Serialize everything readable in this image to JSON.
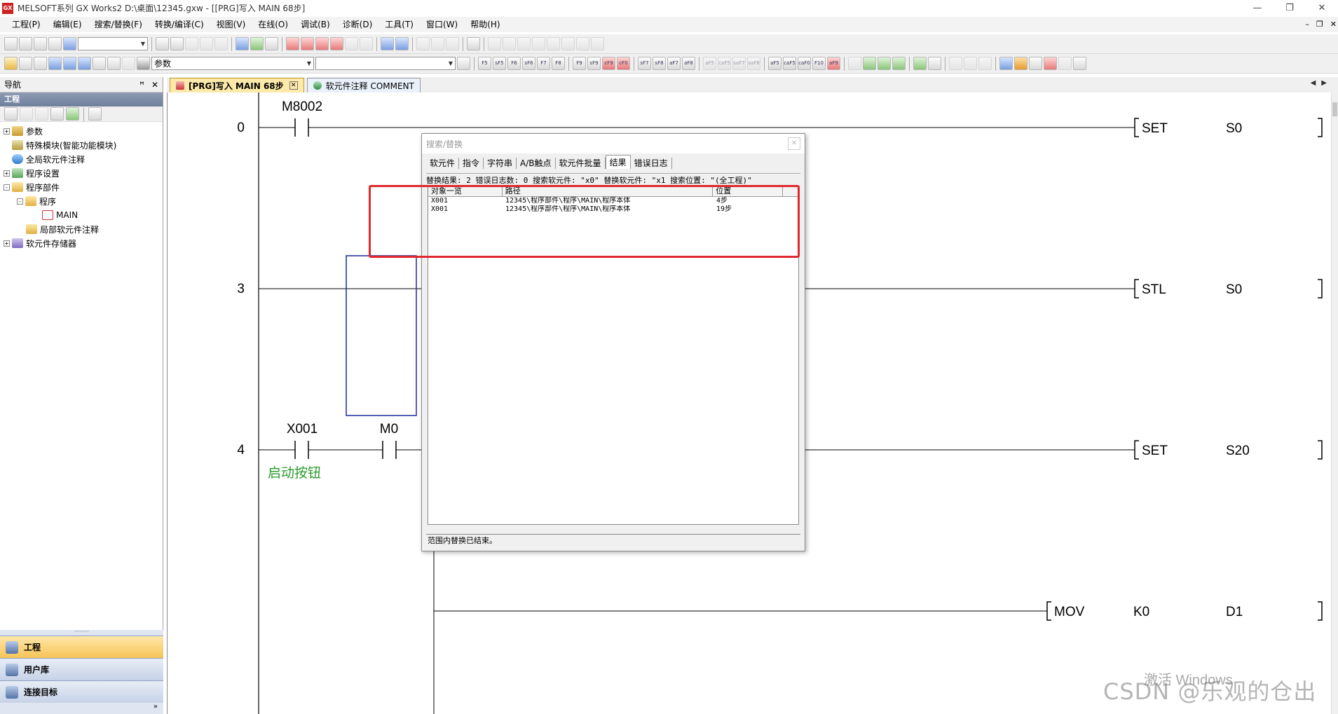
{
  "window": {
    "title": "MELSOFT系列 GX Works2 D:\\桌面\\12345.gxw - [[PRG]写入 MAIN 68步]",
    "icon_text": "GX",
    "controls": [
      "—",
      "❐",
      "✕"
    ]
  },
  "menu": {
    "items": [
      "工程(P)",
      "编辑(E)",
      "搜索/替换(F)",
      "转换/编译(C)",
      "视图(V)",
      "在线(O)",
      "调试(B)",
      "诊断(D)",
      "工具(T)",
      "窗口(W)",
      "帮助(H)"
    ],
    "mdi_controls": [
      "–",
      "❐",
      "✕"
    ]
  },
  "toolbar2": {
    "combo_value": "参数"
  },
  "navigation": {
    "header": "导航",
    "pin": "ꟸ",
    "close": "✕",
    "project_header": "工程",
    "tree": [
      {
        "label": "参数",
        "icon": "param-icon",
        "level": 0,
        "expander": "+"
      },
      {
        "label": "特殊模块(智能功能模块)",
        "icon": "module-icon",
        "level": 0,
        "expander": ""
      },
      {
        "label": "全局软元件注释",
        "icon": "global-comment-icon",
        "level": 0,
        "expander": ""
      },
      {
        "label": "程序设置",
        "icon": "program-setting-icon",
        "level": 0,
        "expander": "+"
      },
      {
        "label": "程序部件",
        "icon": "folder-icon",
        "level": 0,
        "expander": "-"
      },
      {
        "label": "程序",
        "icon": "folder-icon",
        "level": 1,
        "expander": "-"
      },
      {
        "label": "MAIN",
        "icon": "program-file-icon",
        "level": 2,
        "expander": ""
      },
      {
        "label": "局部软元件注释",
        "icon": "folder-icon",
        "level": 1,
        "expander": ""
      },
      {
        "label": "软元件存储器",
        "icon": "memory-icon",
        "level": 0,
        "expander": "+"
      }
    ],
    "bottom_tabs": [
      "工程",
      "用户库",
      "连接目标"
    ],
    "more": "»"
  },
  "doc_tabs": [
    {
      "label": "[PRG]写入 MAIN 68步",
      "active": true
    },
    {
      "label": "软元件注释 COMMENT",
      "active": false
    }
  ],
  "tab_arrows": "◀▶",
  "ladder": {
    "rungs": [
      {
        "step": "0",
        "contact": "M8002",
        "instr": "SET",
        "operand1": "S0"
      },
      {
        "step": "3",
        "instr": "STL",
        "operand1": "S0"
      },
      {
        "step": "4",
        "contact": "X001",
        "contact2": "M0",
        "comment": "启动按钮",
        "instr": "SET",
        "operand1": "S20"
      },
      {
        "step": "",
        "instr": "MOV",
        "operand1": "K0",
        "operand2": "D1"
      }
    ]
  },
  "dialog": {
    "title": "搜索/替换",
    "close": "✕",
    "tabs": [
      "软元件",
      "指令",
      "字符串",
      "A/B触点",
      "软元件批量",
      "结果",
      "错误日志"
    ],
    "active_tab": "结果",
    "info": "替换结果: 2  错误日志数: 0  搜索软元件: \"x0\"  替换软元件: \"x1 搜索位置: \"(全工程)\"",
    "columns": [
      "对象一览",
      "路径",
      "位置"
    ],
    "rows": [
      [
        "X001",
        "12345\\程序部件\\程序\\MAIN\\程序本体",
        "4步"
      ],
      [
        "X001",
        "12345\\程序部件\\程序\\MAIN\\程序本体",
        "19步"
      ]
    ],
    "status": "范围内替换已结束。"
  },
  "watermark": {
    "activate": "激活 Windows",
    "csdn": "CSDN @乐观的仓出"
  },
  "colors": {
    "rung_line": "#000000",
    "comment_green": "#2a9a2a",
    "highlight_red": "#e0282e",
    "select_box_blue": "#1a2a9a"
  }
}
